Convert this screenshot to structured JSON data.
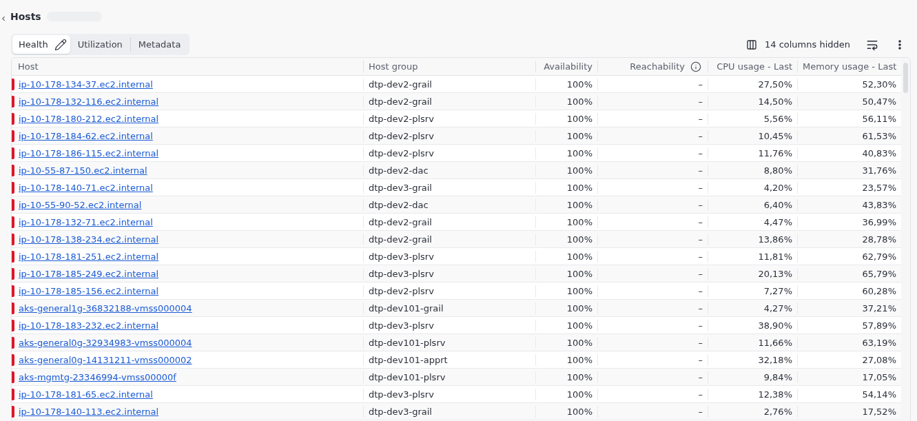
{
  "page": {
    "title": "Hosts"
  },
  "tabs": [
    {
      "label": "Health",
      "selected": true,
      "editable": true
    },
    {
      "label": "Utilization",
      "selected": false,
      "editable": false
    },
    {
      "label": "Metadata",
      "selected": false,
      "editable": false
    }
  ],
  "toolbar": {
    "columns_hidden": "14 columns hidden"
  },
  "table": {
    "columns": [
      {
        "label": "Host",
        "kind": "link",
        "info": false
      },
      {
        "label": "Host group",
        "kind": "text",
        "info": false
      },
      {
        "label": "Availability",
        "kind": "number",
        "info": false
      },
      {
        "label": "Reachability",
        "kind": "number",
        "info": true
      },
      {
        "label": "CPU usage - Last",
        "kind": "number",
        "info": false
      },
      {
        "label": "Memory usage - Last",
        "kind": "number",
        "info": false
      }
    ],
    "rows": [
      {
        "color": "#dc172a",
        "cells": [
          "ip-10-178-134-37.ec2.internal",
          "dtp-dev2-grail",
          "100%",
          "–",
          "27,50%",
          "52,30%"
        ]
      },
      {
        "color": "#dc172a",
        "cells": [
          "ip-10-178-132-116.ec2.internal",
          "dtp-dev2-grail",
          "100%",
          "–",
          "14,50%",
          "50,47%"
        ]
      },
      {
        "color": "#dc172a",
        "cells": [
          "ip-10-178-180-212.ec2.internal",
          "dtp-dev2-plsrv",
          "100%",
          "–",
          "5,56%",
          "56,11%"
        ]
      },
      {
        "color": "#dc172a",
        "cells": [
          "ip-10-178-184-62.ec2.internal",
          "dtp-dev2-plsrv",
          "100%",
          "–",
          "10,45%",
          "61,53%"
        ]
      },
      {
        "color": "#dc172a",
        "cells": [
          "ip-10-178-186-115.ec2.internal",
          "dtp-dev2-plsrv",
          "100%",
          "–",
          "11,76%",
          "40,83%"
        ]
      },
      {
        "color": "#dc172a",
        "cells": [
          "ip-10-55-87-150.ec2.internal",
          "dtp-dev2-dac",
          "100%",
          "–",
          "8,80%",
          "31,76%"
        ]
      },
      {
        "color": "#dc172a",
        "cells": [
          "ip-10-178-140-71.ec2.internal",
          "dtp-dev3-grail",
          "100%",
          "–",
          "4,20%",
          "23,57%"
        ]
      },
      {
        "color": "#dc172a",
        "cells": [
          "ip-10-55-90-52.ec2.internal",
          "dtp-dev2-dac",
          "100%",
          "–",
          "6,40%",
          "43,83%"
        ]
      },
      {
        "color": "#dc172a",
        "cells": [
          "ip-10-178-132-71.ec2.internal",
          "dtp-dev2-grail",
          "100%",
          "–",
          "4,47%",
          "36,99%"
        ]
      },
      {
        "color": "#dc172a",
        "cells": [
          "ip-10-178-138-234.ec2.internal",
          "dtp-dev2-grail",
          "100%",
          "–",
          "13,86%",
          "28,78%"
        ]
      },
      {
        "color": "#dc172a",
        "cells": [
          "ip-10-178-181-251.ec2.internal",
          "dtp-dev3-plsrv",
          "100%",
          "–",
          "11,81%",
          "62,79%"
        ]
      },
      {
        "color": "#dc172a",
        "cells": [
          "ip-10-178-185-249.ec2.internal",
          "dtp-dev3-plsrv",
          "100%",
          "–",
          "20,13%",
          "65,79%"
        ]
      },
      {
        "color": "#dc172a",
        "cells": [
          "ip-10-178-185-156.ec2.internal",
          "dtp-dev2-plsrv",
          "100%",
          "–",
          "7,27%",
          "60,28%"
        ]
      },
      {
        "color": "#dc172a",
        "cells": [
          "aks-general1g-36832188-vmss000004",
          "dtp-dev101-grail",
          "100%",
          "–",
          "4,27%",
          "37,21%"
        ]
      },
      {
        "color": "#dc172a",
        "cells": [
          "ip-10-178-183-232.ec2.internal",
          "dtp-dev3-plsrv",
          "100%",
          "–",
          "38,90%",
          "57,89%"
        ]
      },
      {
        "color": "#dc172a",
        "cells": [
          "aks-general0g-32934983-vmss000004",
          "dtp-dev101-plsrv",
          "100%",
          "–",
          "11,66%",
          "63,19%"
        ]
      },
      {
        "color": "#dc172a",
        "cells": [
          "aks-general0g-14131211-vmss000002",
          "dtp-dev101-apprt",
          "100%",
          "–",
          "32,18%",
          "27,08%"
        ]
      },
      {
        "color": "#dc172a",
        "cells": [
          "aks-mgmtg-23346994-vmss00000f",
          "dtp-dev101-plsrv",
          "100%",
          "–",
          "9,84%",
          "17,05%"
        ]
      },
      {
        "color": "#dc172a",
        "cells": [
          "ip-10-178-181-65.ec2.internal",
          "dtp-dev3-plsrv",
          "100%",
          "–",
          "12,38%",
          "54,14%"
        ]
      },
      {
        "color": "#dc172a",
        "cells": [
          "ip-10-178-140-113.ec2.internal",
          "dtp-dev3-grail",
          "100%",
          "–",
          "2,76%",
          "17,52%"
        ]
      }
    ]
  }
}
